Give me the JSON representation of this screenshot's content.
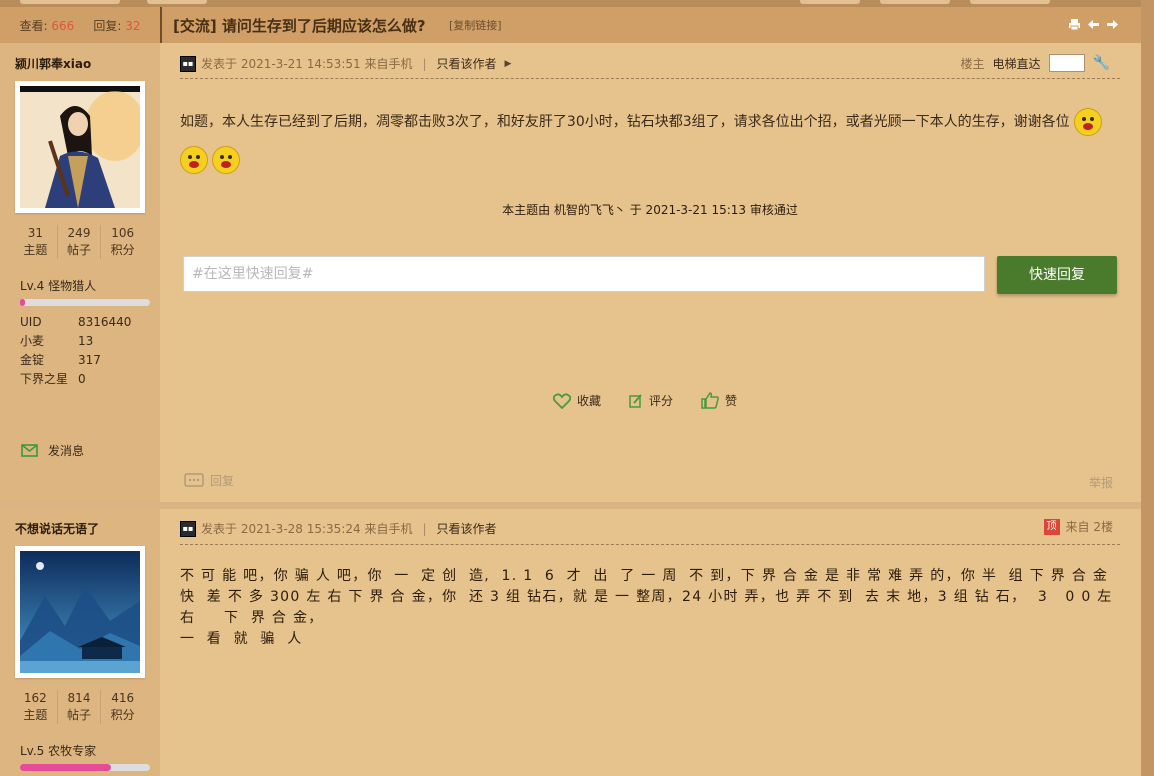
{
  "header": {
    "views_label": "查看:",
    "views": "666",
    "replies_label": "回复:",
    "replies": "32",
    "title": "[交流] 请问生存到了后期应该怎么做?",
    "copy_link": "[复制链接]"
  },
  "post1": {
    "author": "颍川郭奉xiao",
    "stats": [
      {
        "value": "31",
        "label": "主题"
      },
      {
        "value": "249",
        "label": "帖子"
      },
      {
        "value": "106",
        "label": "积分"
      }
    ],
    "level": "Lv.4 怪物猎人",
    "level_progress": 0.04,
    "info": [
      {
        "k": "UID",
        "v": "8316440"
      },
      {
        "k": "小麦",
        "v": "13"
      },
      {
        "k": "金锭",
        "v": "317"
      },
      {
        "k": "下界之星",
        "v": "0"
      }
    ],
    "send_msg": "发消息",
    "posted": "发表于 2021-3-21 14:53:51 来自手机",
    "only_author": "只看该作者",
    "floor_label": "楼主",
    "elevator": "电梯直达",
    "content": "如题，本人生存已经到了后期，凋零都击败3次了，和好友肝了30小时，钻石块都3组了，请求各位出个招，或者光顾一下本人的生存，谢谢各位",
    "audit": "本主题由 机智的飞飞丶 于 2021-3-21 15:13 审核通过",
    "quick_reply_placeholder": "#在这里快速回复#",
    "quick_reply_button": "快速回复",
    "actions": {
      "fav": "收藏",
      "rate": "评分",
      "like": "赞"
    },
    "reply": "回复",
    "report": "举报"
  },
  "post2": {
    "author": "不想说话无语了",
    "stats": [
      {
        "value": "162",
        "label": "主题"
      },
      {
        "value": "814",
        "label": "帖子"
      },
      {
        "value": "416",
        "label": "积分"
      }
    ],
    "level": "Lv.5 农牧专家",
    "level_progress": 0.7,
    "posted": "发表于 2021-3-28 15:35:24 来自手机",
    "only_author": "只看该作者",
    "top_badge": "顶",
    "floor": "来自 2楼",
    "content": "不 可 能 吧，你 骗 人 吧，你  一  定 创  造,  1. 1  6  才  出  了 一 周  不 到，下 界 合 金 是 非 常 难 弄 的，你 半  组 下 界 合 金 快  差 不 多 300 左 右 下 界 合 金，你  还 3 组 钻石，就 是 一 整周，24 小时 弄，也 弄 不 到  去 末 地，3 组 钻 石，  3   0 0 左  右     下  界 合 金，\n一  看  就  骗  人"
  },
  "colors": {
    "page_bg": "#e6c28d",
    "header_bg": "#cf9f67",
    "reply_button": "#4a7a2c",
    "accent_number": "#e0563f",
    "level_bar": "#e44c9a"
  }
}
